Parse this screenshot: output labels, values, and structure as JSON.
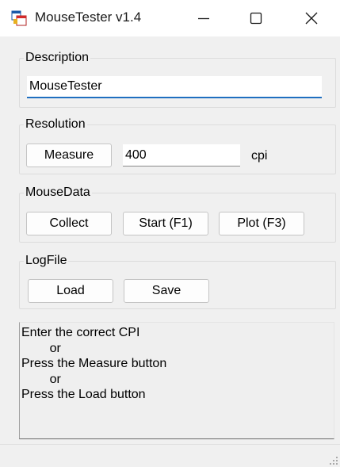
{
  "window": {
    "title": "MouseTester v1.4"
  },
  "description": {
    "legend": "Description",
    "value": "MouseTester"
  },
  "resolution": {
    "legend": "Resolution",
    "measure_label": "Measure",
    "cpi_value": "400",
    "unit": "cpi"
  },
  "mousedata": {
    "legend": "MouseData",
    "collect_label": "Collect",
    "start_label": "Start (F1)",
    "plot_label": "Plot (F3)"
  },
  "logfile": {
    "legend": "LogFile",
    "load_label": "Load",
    "save_label": "Save"
  },
  "log": {
    "lines": [
      "Enter the correct CPI",
      "        or",
      "Press the Measure button",
      "        or",
      "Press the Load button"
    ]
  },
  "icons": {
    "app": "mousetester-app-icon",
    "minimize": "minimize-icon",
    "maximize": "maximize-icon",
    "close": "close-icon"
  },
  "colors": {
    "focus_underline": "#1f6fc0",
    "window_bg": "#f0f0f0"
  }
}
